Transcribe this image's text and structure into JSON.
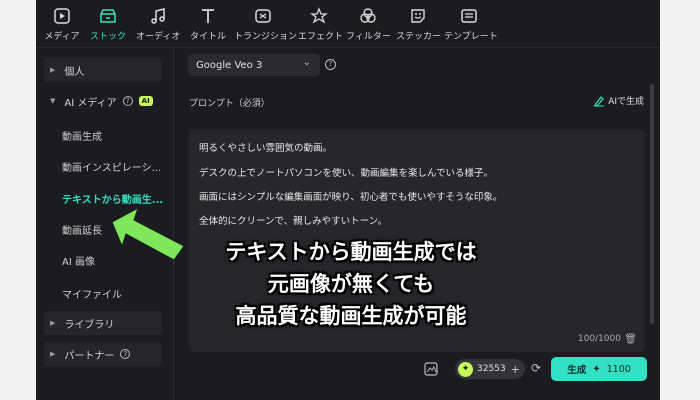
{
  "toolbar": {
    "items": [
      {
        "label": "メディア",
        "icon": "media-icon"
      },
      {
        "label": "ストック",
        "icon": "stock-icon",
        "active": true
      },
      {
        "label": "オーディオ",
        "icon": "music-note-icon"
      },
      {
        "label": "タイトル",
        "icon": "title-t-icon"
      },
      {
        "label": "トランジション",
        "icon": "transition-icon"
      },
      {
        "label": "エフェクト",
        "icon": "effect-star-icon"
      },
      {
        "label": "フィルター",
        "icon": "filter-icon"
      },
      {
        "label": "ステッカー",
        "icon": "sticker-icon"
      },
      {
        "label": "テンプレート",
        "icon": "template-icon"
      }
    ]
  },
  "sidebar": {
    "personal": "個人",
    "ai_media": "AI メディア",
    "ai_badge": "AI",
    "sub_items": [
      "動画生成",
      "動画インスピレーシ...",
      "テキストから動画生...",
      "動画延長",
      "AI 画像",
      "マイファイル"
    ],
    "library": "ライブラリ",
    "partner": "パートナー"
  },
  "main": {
    "model": "Google Veo 3",
    "prompt_label": "プロンプト（必須）",
    "ai_generate": "AIで生成",
    "prompt_lines": [
      "明るくやさしい雰囲気の動画。",
      "デスクの上でノートパソコンを使い、動画編集を楽しんでいる様子。",
      "画面にはシンプルな編集画面が映り、初心者でも使いやすそうな印象。",
      "全体的にクリーンで、親しみやすいトーン。"
    ],
    "char_count": "100/1000",
    "credits": "32553",
    "generate_label": "生成",
    "generate_cost": "1100"
  },
  "overlay": {
    "lines": [
      "テキストから動画生成では",
      "元画像が無くても",
      "高品質な動画生成が可能"
    ]
  },
  "colors": {
    "accent": "#34e0c4",
    "badge": "#c9f85a",
    "arrow": "#7ee85a",
    "background": "#1b1c1f"
  }
}
